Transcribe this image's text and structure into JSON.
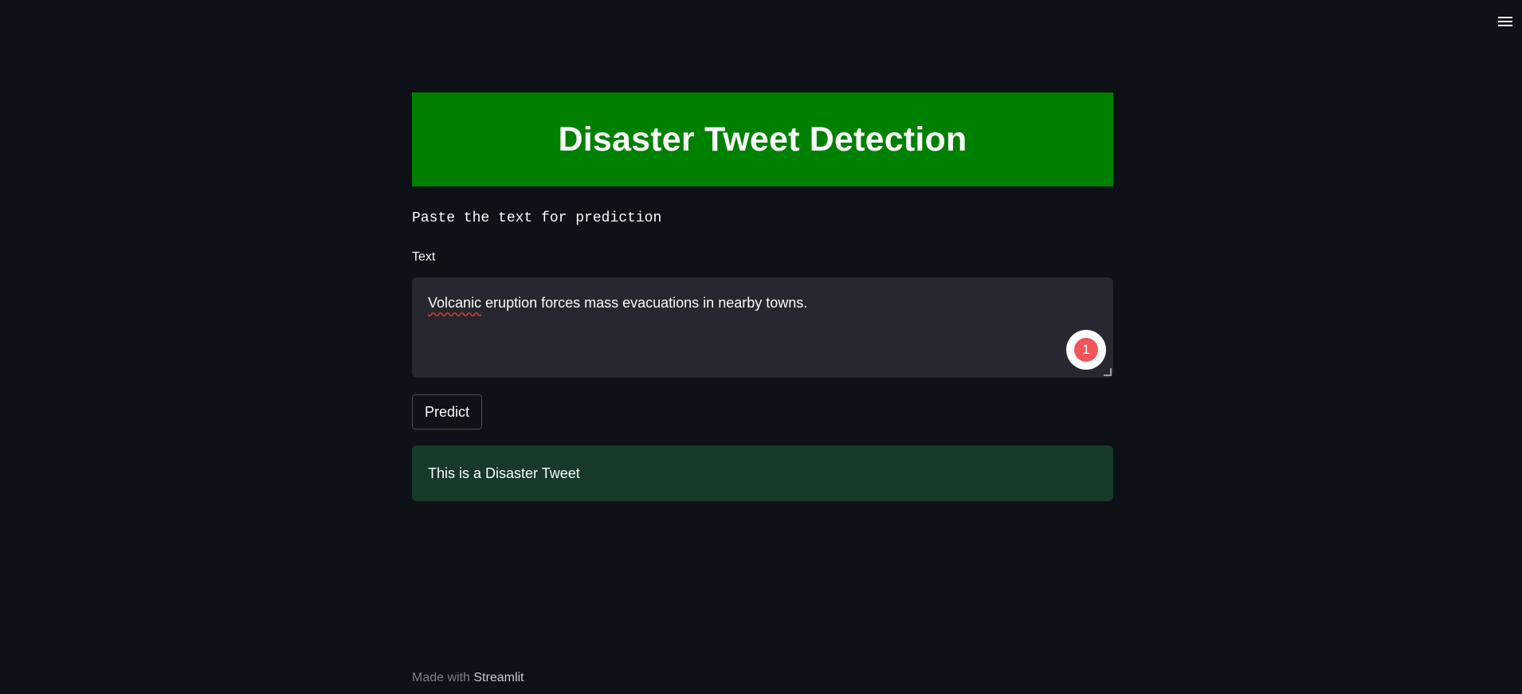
{
  "menu": {
    "icon": "hamburger-menu-icon"
  },
  "header": {
    "title": "Disaster Tweet Detection",
    "background": "#008000"
  },
  "instruction": "Paste the text for prediction",
  "input": {
    "label": "Text",
    "misspelled_word": "Volcanic",
    "rest_of_value": " eruption forces mass evacuations in nearby towns.",
    "grammarly_count": "1"
  },
  "actions": {
    "predict_label": "Predict"
  },
  "result": {
    "message": "This is a Disaster Tweet",
    "background": "#173928"
  },
  "footer": {
    "made_with": "Made with ",
    "brand": "Streamlit"
  }
}
